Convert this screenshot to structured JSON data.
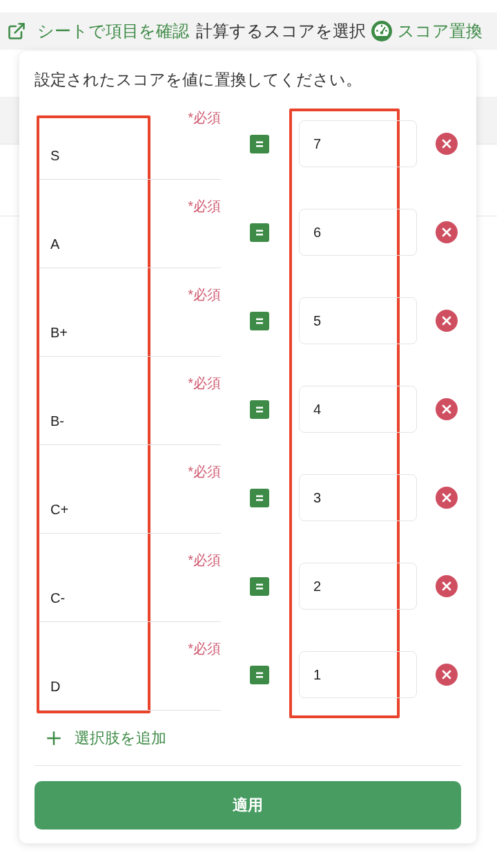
{
  "toolbar": {
    "sheet_link": "シートで項目を確認",
    "title": "計算するスコアを選択",
    "score_replace": "スコア置換"
  },
  "popover": {
    "description": "設定されたスコアを値に置換してください。",
    "rows": [
      {
        "label": "S",
        "required": "*必須",
        "value": "7"
      },
      {
        "label": "A",
        "required": "*必須",
        "value": "6"
      },
      {
        "label": "B+",
        "required": "*必須",
        "value": "5"
      },
      {
        "label": "B-",
        "required": "*必須",
        "value": "4"
      },
      {
        "label": "C+",
        "required": "*必須",
        "value": "3"
      },
      {
        "label": "C-",
        "required": "*必須",
        "value": "2"
      },
      {
        "label": "D",
        "required": "*必須",
        "value": "1"
      }
    ],
    "add_option": "選択肢を追加",
    "apply": "適用"
  },
  "highlight_frames": {
    "labels": true,
    "values": true
  }
}
